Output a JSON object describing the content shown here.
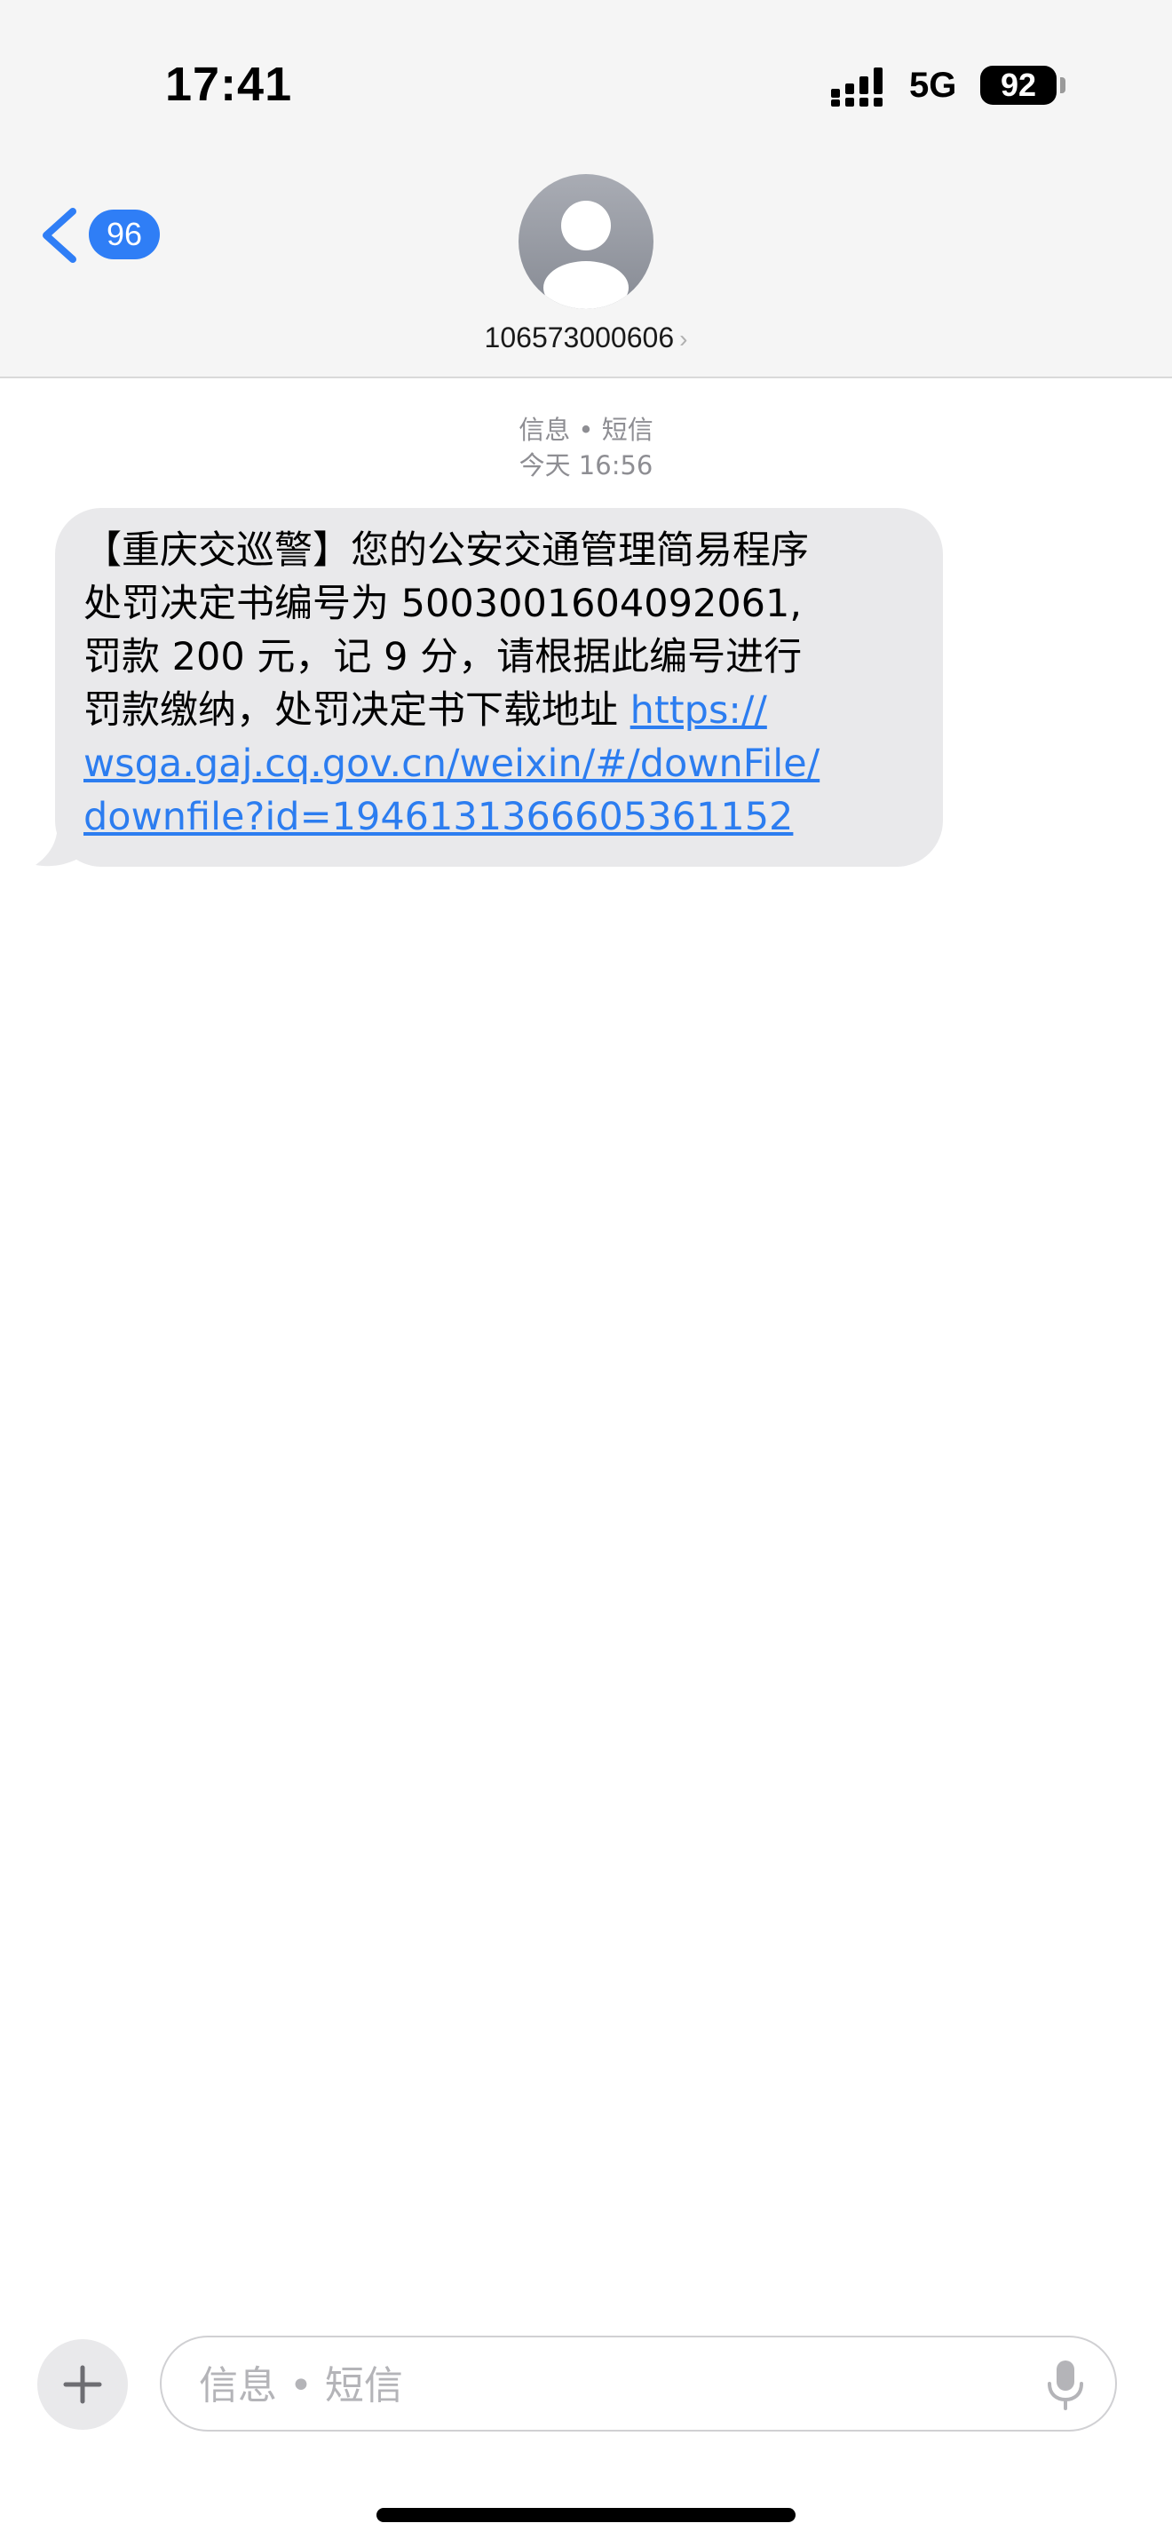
{
  "status_bar": {
    "time": "17:41",
    "network": "5G",
    "battery": "92"
  },
  "nav": {
    "back_count": "96",
    "contact": "106573000606",
    "chevron": "›"
  },
  "conversation": {
    "service": "信息 • 短信",
    "timestamp": "今天 16:56",
    "message_text": "【重庆交巡警】您的公安交通管理简易程序\n处罚决定书编号为 5003001604092061,\n罚款 200 元，记 9 分，请根据此编号进行\n罚款缴纳，处罚决定书下载地址 ",
    "message_link": "https://\nwsga.gaj.cq.gov.cn/weixin/#/downFile/\ndownfile?id=1946131366605361152"
  },
  "composer": {
    "placeholder": "信息 • 短信"
  },
  "colors": {
    "accent": "#2f7ef6",
    "link": "#2c7df0",
    "bubble": "#e9e9eb",
    "header_bg": "#f5f5f5"
  },
  "icons": [
    "back-chevron-icon",
    "contact-avatar-icon",
    "plus-icon",
    "microphone-icon",
    "signal-icon"
  ]
}
